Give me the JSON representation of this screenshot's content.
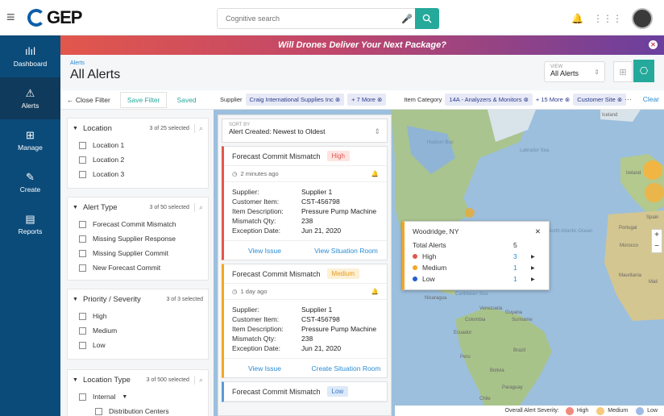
{
  "topbar": {
    "logo_text": "GEP",
    "search_placeholder": "Cognitive search"
  },
  "sidebar": {
    "items": [
      {
        "label": "Dashboard",
        "icon": "chart-icon"
      },
      {
        "label": "Alerts",
        "icon": "warning-icon"
      },
      {
        "label": "Manage",
        "icon": "briefcase-icon"
      },
      {
        "label": "Create",
        "icon": "edit-icon"
      },
      {
        "label": "Reports",
        "icon": "report-icon"
      }
    ],
    "active": "Alerts"
  },
  "banner": {
    "text": "Will Drones Deliver Your Next Package?"
  },
  "page": {
    "breadcrumb": "Alerts",
    "title": "All Alerts",
    "view_label": "VIEW",
    "view_value": "All Alerts"
  },
  "filterbar": {
    "close_filter": "Close Filter",
    "save_filter": "Save Filter",
    "saved": "Saved",
    "supplier_label": "Supplier",
    "supplier_chip": "Craig International Supplies Inc",
    "supplier_more": "+ 7 More",
    "category_label": "Item Category",
    "category_chip": "14A - Analyzers & Monitors",
    "category_more": "+ 15 More",
    "site_chip": "Customer Site",
    "more_dots": "···",
    "clear": "Clear"
  },
  "filters": {
    "location": {
      "name": "Location",
      "count": "3 of 25 selected",
      "items": [
        "Location 1",
        "Location 2",
        "Location 3"
      ]
    },
    "alert_type": {
      "name": "Alert Type",
      "count": "3 of 50 selected",
      "items": [
        "Forecast Commit Mismatch",
        "Missing Supplier Response",
        "Missing Supplier Commit",
        "New Forecast Commit"
      ]
    },
    "priority": {
      "name": "Priority / Severity",
      "count": "3 of 3 selected",
      "items": [
        "High",
        "Medium",
        "Low"
      ]
    },
    "location_type": {
      "name": "Location Type",
      "count": "3 of 500 selected",
      "items": [
        "Internal",
        "Distribution Centers"
      ]
    }
  },
  "sort": {
    "label": "SORT BY",
    "value": "Alert Created: Newest to Oldest"
  },
  "labels": {
    "supplier": "Supplier:",
    "customer_item": "Customer Item:",
    "item_description": "Item Description:",
    "mismatch_qty": "Mismatch Qty:",
    "exception_date": "Exception Date:",
    "view_issue": "View Issue"
  },
  "alerts": [
    {
      "title": "Forecast Commit Mismatch",
      "priority": "High",
      "time": "2 minutes ago",
      "supplier": "Supplier 1",
      "customer_item": "CST-456798",
      "description": "Pressure Pump Machine",
      "qty": "238",
      "date": "Jun 21, 2020",
      "action2": "View Situation Room",
      "color": "#e2574c"
    },
    {
      "title": "Forecast Commit Mismatch",
      "priority": "Medium",
      "time": "1 day ago",
      "supplier": "Supplier 1",
      "customer_item": "CST-456798",
      "description": "Pressure Pump Machine",
      "qty": "238",
      "date": "Jun 21, 2020",
      "action2": "Create Situation Room",
      "color": "#f4a623"
    },
    {
      "title": "Forecast Commit Mismatch",
      "priority": "Low",
      "color": "#5b9bd5"
    }
  ],
  "popup": {
    "location": "Woodridge, NY",
    "total_label": "Total Alerts",
    "total": "5",
    "rows": [
      {
        "name": "High",
        "count": "3",
        "color": "#e2574c"
      },
      {
        "name": "Medium",
        "count": "1",
        "color": "#f4a623"
      },
      {
        "name": "Low",
        "count": "1",
        "color": "#1f5fd1"
      }
    ]
  },
  "map_labels": {
    "hudson_bay": "Hudson Bay",
    "labrador_sea": "Labrador Sea",
    "iceland": "Iceland",
    "ireland": "Ireland",
    "north_atlantic": "North Atlantic Ocean",
    "spain": "Spain",
    "portugal": "Portugal",
    "morocco": "Morocco",
    "mauritania": "Mauritania",
    "mali": "Mali",
    "venezuela": "Venezuela",
    "colombia": "Colombia",
    "ecuador": "Ecuador",
    "peru": "Peru",
    "brazil": "Brazil",
    "bolivia": "Bolivia",
    "paraguay": "Paraguay",
    "chile": "Chile",
    "caribbean_sea": "Caribbean Sea",
    "nicaragua": "Nicaragua",
    "suriname": "Suriname",
    "guyana": "Guyana"
  },
  "legend": {
    "label": "Overall Alert Severity:",
    "items": [
      {
        "name": "High",
        "color": "#f08a7e"
      },
      {
        "name": "Medium",
        "color": "#f7c97a"
      },
      {
        "name": "Low",
        "color": "#9dbbe6"
      }
    ]
  }
}
